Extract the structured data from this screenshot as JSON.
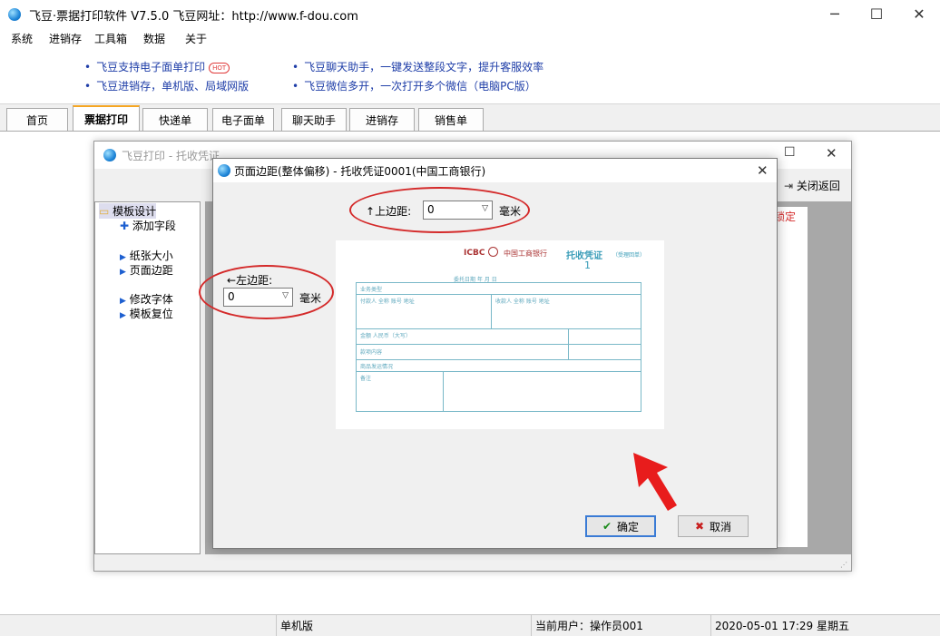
{
  "app": {
    "title": "飞豆·票据打印软件 V7.5.0  飞豆网址：http://www.f-dou.com",
    "window_controls": [
      "─",
      "☐",
      "✕"
    ]
  },
  "menu": [
    "系统",
    "进销存",
    "工具箱",
    "数据",
    "关于"
  ],
  "ads": {
    "left1": "飞豆支持电子面单打印",
    "hot": "HOT",
    "left2": "飞豆进销存，单机版、局域网版",
    "right1": "飞豆聊天助手，一键发送整段文字，提升客服效率",
    "right2": "飞豆微信多开，一次打开多个微信（电脑PC版）"
  },
  "tabs": [
    "首页",
    "票据打印",
    "快递单",
    "电子面单",
    "聊天助手",
    "进销存",
    "销售单"
  ],
  "active_tab": "票据打印",
  "status": {
    "edition": "单机版",
    "user": "当前用户：操作员001",
    "datetime": "2020-05-01 17:29 星期五"
  },
  "print_window": {
    "title": "飞豆打印 - 托收凭证",
    "close_return": "关闭返回",
    "lock_text": "锁定",
    "tree": {
      "root": "模板设计",
      "items": [
        "添加字段",
        "纸张大小",
        "页面边距",
        "修改字体",
        "模板复位"
      ]
    }
  },
  "dialog": {
    "title": "页面边距(整体偏移) - 托收凭证0001(中国工商银行)",
    "top_label": "上边距:",
    "top_value": "0",
    "top_unit": "毫米",
    "left_label": "左边距:",
    "left_value": "0",
    "left_unit": "毫米",
    "ok": "确定",
    "cancel": "取消",
    "voucher": {
      "bank_logo": "ICBC",
      "bank_name": "中国工商银行",
      "form_name": "托收凭证",
      "form_note": "（受理回单）",
      "number": "1",
      "date_label": "委托日期      年    月    日",
      "rows": [
        "业务类型",
        "付款人 全称 账号 地址",
        "收款人 全称 账号 地址",
        "金额 人民币（大写）",
        "款项内容",
        "商品发运情况",
        "备注"
      ]
    }
  },
  "colors": {
    "accent_tab": "#f5a623",
    "ad_text": "#1f3ea8",
    "annotation": "#d42a2a",
    "voucher_line": "#79b8c8"
  }
}
